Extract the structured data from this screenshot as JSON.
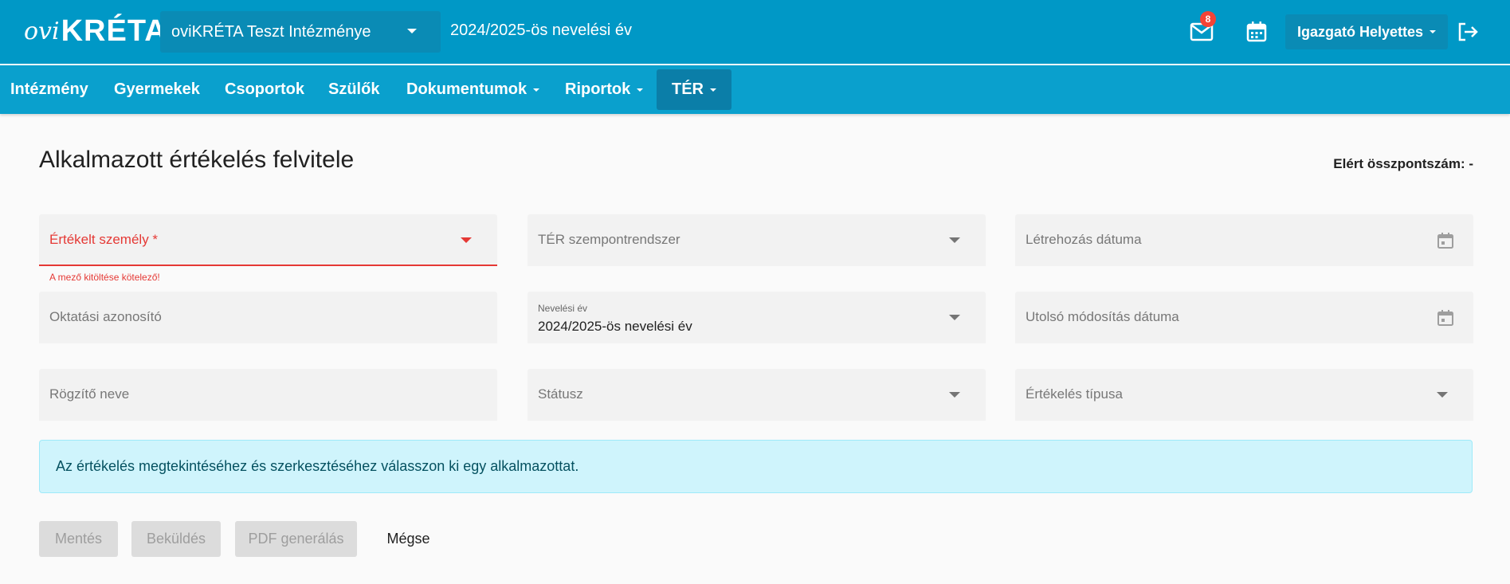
{
  "header": {
    "logo_prefix": "ovi",
    "logo_main": "KRÉTA",
    "institution": "oviKRÉTA Teszt Intézménye",
    "school_year": "2024/2025-ös nevelési év",
    "mail_badge": "8",
    "user": "Igazgató Helyettes"
  },
  "nav": {
    "items": [
      "Intézmény",
      "Gyermekek",
      "Csoportok",
      "Szülők",
      "Dokumentumok",
      "Riportok",
      "TÉR"
    ],
    "active": "TÉR"
  },
  "page": {
    "title": "Alkalmazott értékelés felvitele",
    "score_label": "Elért összpontszám: -"
  },
  "form": {
    "evaluated_person": "Értékelt személy *",
    "error_message": "A mező kitöltése kötelező!",
    "ter_system": "TÉR szempontrendszer",
    "created_date": "Létrehozás dátuma",
    "education_id": "Oktatási azonosító",
    "school_year_label": "Nevelési év",
    "school_year_value": "2024/2025-ös nevelési év",
    "modified_date": "Utolsó módosítás dátuma",
    "recorder_name": "Rögzítő neve",
    "status": "Státusz",
    "eval_type": "Értékelés típusa"
  },
  "info": "Az értékelés megtekintéséhez és szerkesztéséhez válasszon ki egy alkalmazottat.",
  "buttons": {
    "save": "Mentés",
    "submit": "Beküldés",
    "pdf": "PDF generálás",
    "cancel": "Mégse"
  },
  "colors": {
    "header": "#0098c6",
    "nav": "#0aa0cd",
    "error": "#e53935",
    "info_bg": "#cff4fc"
  }
}
